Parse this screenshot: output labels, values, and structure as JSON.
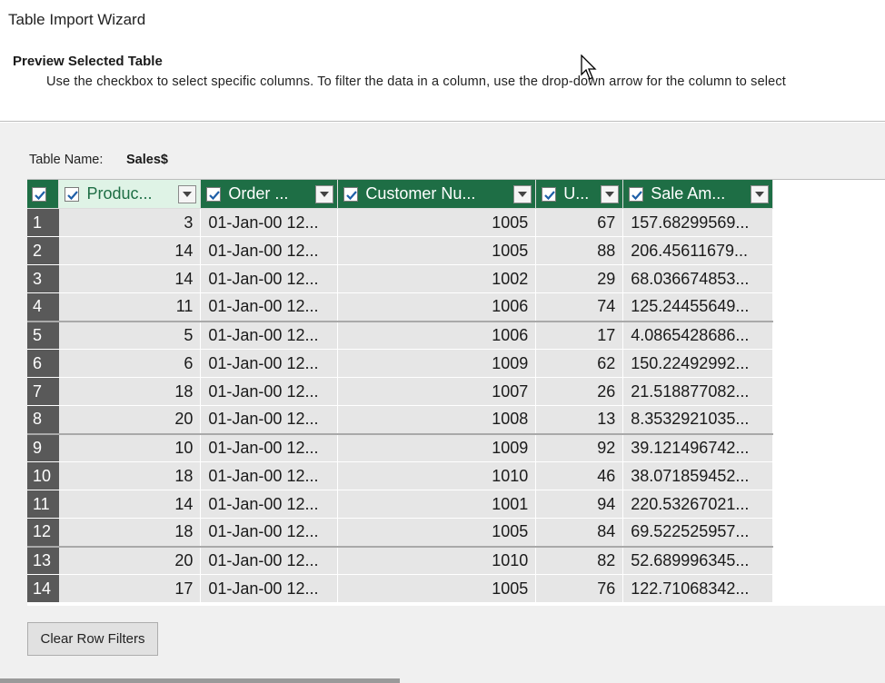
{
  "window": {
    "title": "Table Import Wizard"
  },
  "preview": {
    "title": "Preview Selected Table",
    "description": "Use the checkbox to select specific columns. To filter the data in a column, use the drop-down arrow  for the column to select"
  },
  "table_name": {
    "label": "Table Name:",
    "value": "Sales$"
  },
  "columns": [
    {
      "label": "Produc...",
      "checked": true
    },
    {
      "label": "Order ...",
      "checked": true
    },
    {
      "label": "Customer Nu...",
      "checked": true
    },
    {
      "label": "U...",
      "checked": true
    },
    {
      "label": "Sale Am...",
      "checked": true
    }
  ],
  "rows": [
    [
      "1",
      "3",
      "01-Jan-00 12...",
      "1005",
      "67",
      "157.68299569..."
    ],
    [
      "2",
      "14",
      "01-Jan-00 12...",
      "1005",
      "88",
      "206.45611679..."
    ],
    [
      "3",
      "14",
      "01-Jan-00 12...",
      "1002",
      "29",
      "68.036674853..."
    ],
    [
      "4",
      "11",
      "01-Jan-00 12...",
      "1006",
      "74",
      "125.24455649..."
    ],
    [
      "5",
      "5",
      "01-Jan-00 12...",
      "1006",
      "17",
      "4.0865428686..."
    ],
    [
      "6",
      "6",
      "01-Jan-00 12...",
      "1009",
      "62",
      "150.22492992..."
    ],
    [
      "7",
      "18",
      "01-Jan-00 12...",
      "1007",
      "26",
      "21.518877082..."
    ],
    [
      "8",
      "20",
      "01-Jan-00 12...",
      "1008",
      "13",
      "8.3532921035..."
    ],
    [
      "9",
      "10",
      "01-Jan-00 12...",
      "1009",
      "92",
      "39.121496742..."
    ],
    [
      "10",
      "18",
      "01-Jan-00 12...",
      "1010",
      "46",
      "38.071859452..."
    ],
    [
      "11",
      "14",
      "01-Jan-00 12...",
      "1001",
      "94",
      "220.53267021..."
    ],
    [
      "12",
      "18",
      "01-Jan-00 12...",
      "1005",
      "84",
      "69.522525957..."
    ],
    [
      "13",
      "20",
      "01-Jan-00 12...",
      "1010",
      "82",
      "52.689996345..."
    ],
    [
      "14",
      "17",
      "01-Jan-00 12...",
      "1005",
      "76",
      "122.71068342..."
    ]
  ],
  "buttons": {
    "clear_row_filters": "Clear Row Filters"
  },
  "colors": {
    "header_green": "#1e6e45",
    "selected_header": "#dff3e6",
    "rownum_bg": "#595959",
    "cell_bg": "#e6e6e6",
    "panel_bg": "#f0f0f0"
  },
  "icons": {
    "checkbox": "checkbox-checked-icon",
    "dropdown": "chevron-down-icon"
  }
}
